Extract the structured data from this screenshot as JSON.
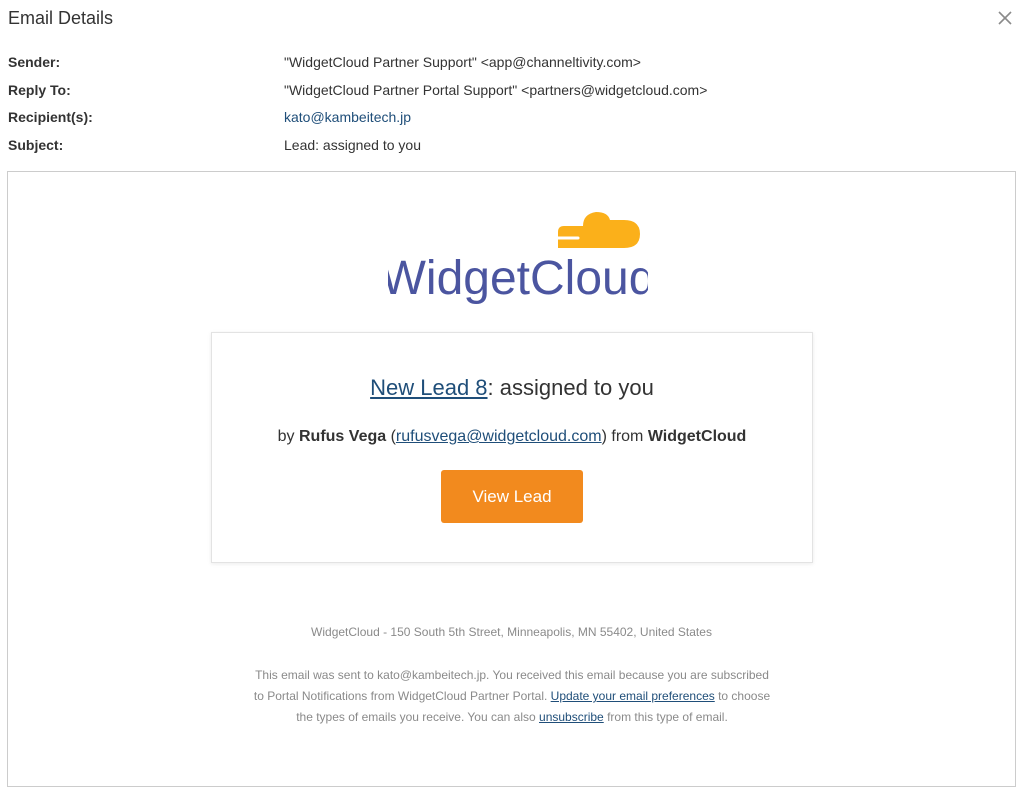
{
  "dialog": {
    "title": "Email Details",
    "close_icon": "close-icon"
  },
  "meta": {
    "sender_label": "Sender:",
    "sender_value": "\"WidgetCloud Partner Support\" <app@channeltivity.com>",
    "reply_to_label": "Reply To:",
    "reply_to_value": "\"WidgetCloud Partner Portal Support\" <partners@widgetcloud.com>",
    "recipients_label": "Recipient(s):",
    "recipients_value": "kato@kambeitech.jp",
    "subject_label": "Subject:",
    "subject_value": "Lead: assigned to you"
  },
  "email": {
    "logo_text": "WidgetCloud",
    "headline_link": "New Lead 8",
    "headline_rest": ": assigned to you",
    "by_prefix": "by ",
    "by_name": "Rufus Vega",
    "by_open": " (",
    "by_email": "rufusvega@widgetcloud.com",
    "by_close": ") from ",
    "by_company": "WidgetCloud",
    "button_label": "View Lead",
    "address": "WidgetCloud - 150 South 5th Street, Minneapolis, MN 55402, United States",
    "note_part1": "This email was sent to kato@kambeitech.jp. You received this email because you are subscribed to Portal Notifications from WidgetCloud Partner Portal. ",
    "note_link1": "Update your email preferences",
    "note_part2": " to choose the types of emails you receive. You can also ",
    "note_link2": "unsubscribe",
    "note_part3": " from this type of email."
  },
  "colors": {
    "accent_orange": "#f28a1e",
    "logo_blue": "#4b55a0",
    "logo_yellow": "#fbb01a",
    "link_blue": "#1f4e79"
  }
}
